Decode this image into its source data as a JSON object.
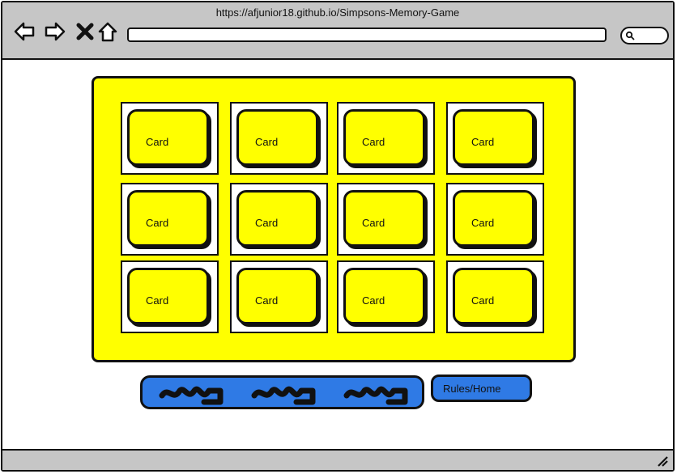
{
  "browser": {
    "url": "https://afjunior18.github.io/Simpsons-Memory-Game",
    "icons": [
      "back-arrow-icon",
      "forward-arrow-icon",
      "close-icon",
      "home-icon",
      "search-icon",
      "resize-handle-icon"
    ]
  },
  "board": {
    "rows": [
      [
        {
          "label": "Card"
        },
        {
          "label": "Card"
        },
        {
          "label": "Card"
        },
        {
          "label": "Card"
        }
      ],
      [
        {
          "label": "Card"
        },
        {
          "label": "Card"
        },
        {
          "label": "Card"
        },
        {
          "label": "Card"
        }
      ],
      [
        {
          "label": "Card"
        },
        {
          "label": "Card"
        },
        {
          "label": "Card"
        },
        {
          "label": "Card"
        }
      ]
    ]
  },
  "controls": {
    "rules_home_label": "Rules/Home"
  },
  "colors": {
    "board": "#ffff00",
    "button": "#2f7ae5",
    "chrome": "#c6c6c6"
  }
}
